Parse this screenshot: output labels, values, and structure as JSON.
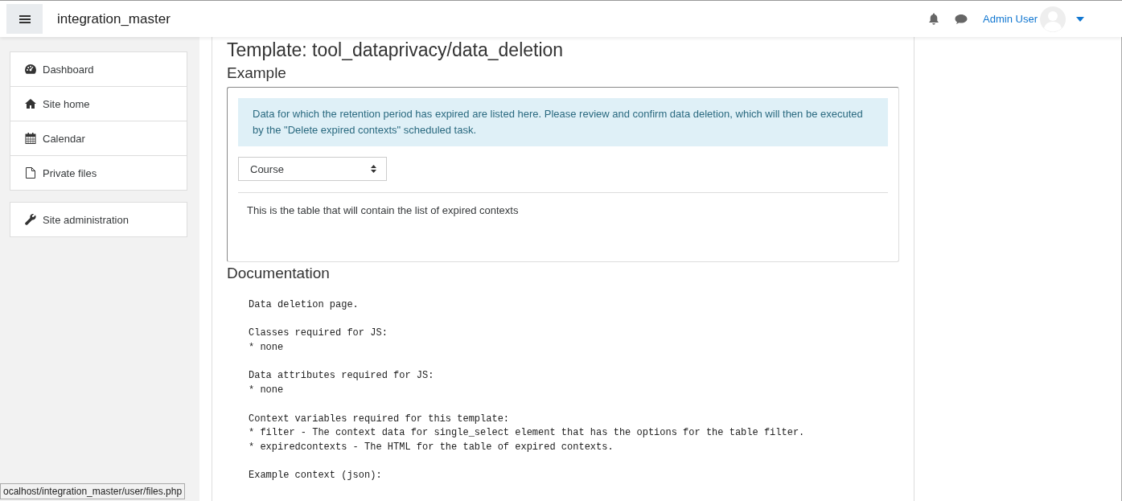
{
  "header": {
    "site_name": "integration_master",
    "user_name": "Admin User"
  },
  "sidebar": {
    "groups": [
      {
        "items": [
          {
            "label": "Dashboard",
            "kind": "dashboard"
          },
          {
            "label": "Site home",
            "kind": "home"
          },
          {
            "label": "Calendar",
            "kind": "calendar"
          },
          {
            "label": "Private files",
            "kind": "file"
          }
        ]
      },
      {
        "items": [
          {
            "label": "Site administration",
            "kind": "wrench"
          }
        ]
      }
    ]
  },
  "main": {
    "title": "Template: tool_dataprivacy/data_deletion",
    "example_heading": "Example",
    "alert": "Data for which the retention period has expired are listed here. Please review and confirm data deletion, which will then be executed by the \"Delete expired contexts\" scheduled task.",
    "filter_select": {
      "value": "Course"
    },
    "table_text": "This is the table that will contain the list of expired contexts",
    "documentation_heading": "Documentation",
    "documentation": [
      [
        "Data deletion page."
      ],
      [
        "Classes required for JS:",
        "* none"
      ],
      [
        "Data attributes required for JS:",
        "* none"
      ],
      [
        "Context variables required for this template:",
        "* filter - The context data for single_select element that has the options for the table filter.",
        "* expiredcontexts - The HTML for the table of expired contexts."
      ],
      [
        "Example context (json):"
      ]
    ]
  },
  "status_bar": {
    "url": "ocalhost/integration_master/user/files.php"
  }
}
